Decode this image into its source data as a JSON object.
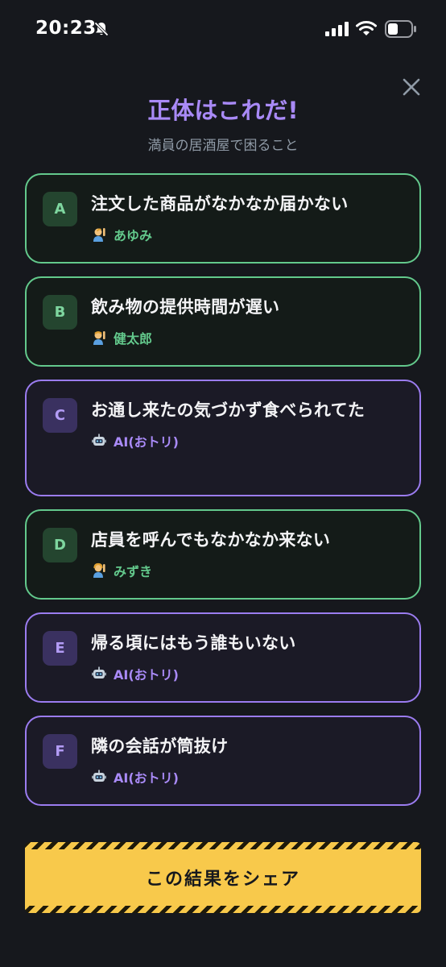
{
  "status": {
    "time": "20:23"
  },
  "header": {
    "title": "正体はこれだ!",
    "subtitle": "満員の居酒屋で困ること"
  },
  "cards": [
    {
      "letter": "A",
      "text": "注文した商品がなかなか届かない",
      "author": "あゆみ",
      "kind": "human",
      "icon": "person-raising-hand-icon"
    },
    {
      "letter": "B",
      "text": "飲み物の提供時間が遅い",
      "author": "健太郎",
      "kind": "human",
      "icon": "person-raising-hand-icon"
    },
    {
      "letter": "C",
      "text": "お通し来たの気づかず食べられてた",
      "author": "AI(おトリ)",
      "kind": "ai",
      "icon": "robot-icon"
    },
    {
      "letter": "D",
      "text": "店員を呼んでもなかなか来ない",
      "author": "みずき",
      "kind": "human",
      "icon": "person-raising-hand-icon"
    },
    {
      "letter": "E",
      "text": "帰る頃にはもう誰もいない",
      "author": "AI(おトリ)",
      "kind": "ai",
      "icon": "robot-icon"
    },
    {
      "letter": "F",
      "text": "隣の会話が筒抜け",
      "author": "AI(おトリ)",
      "kind": "ai",
      "icon": "robot-icon"
    }
  ],
  "share": {
    "label": "この結果をシェア"
  },
  "colors": {
    "human": "#63c98c",
    "ai": "#9b7cf0",
    "accent": "#a98af7",
    "share": "#f8c94b"
  }
}
